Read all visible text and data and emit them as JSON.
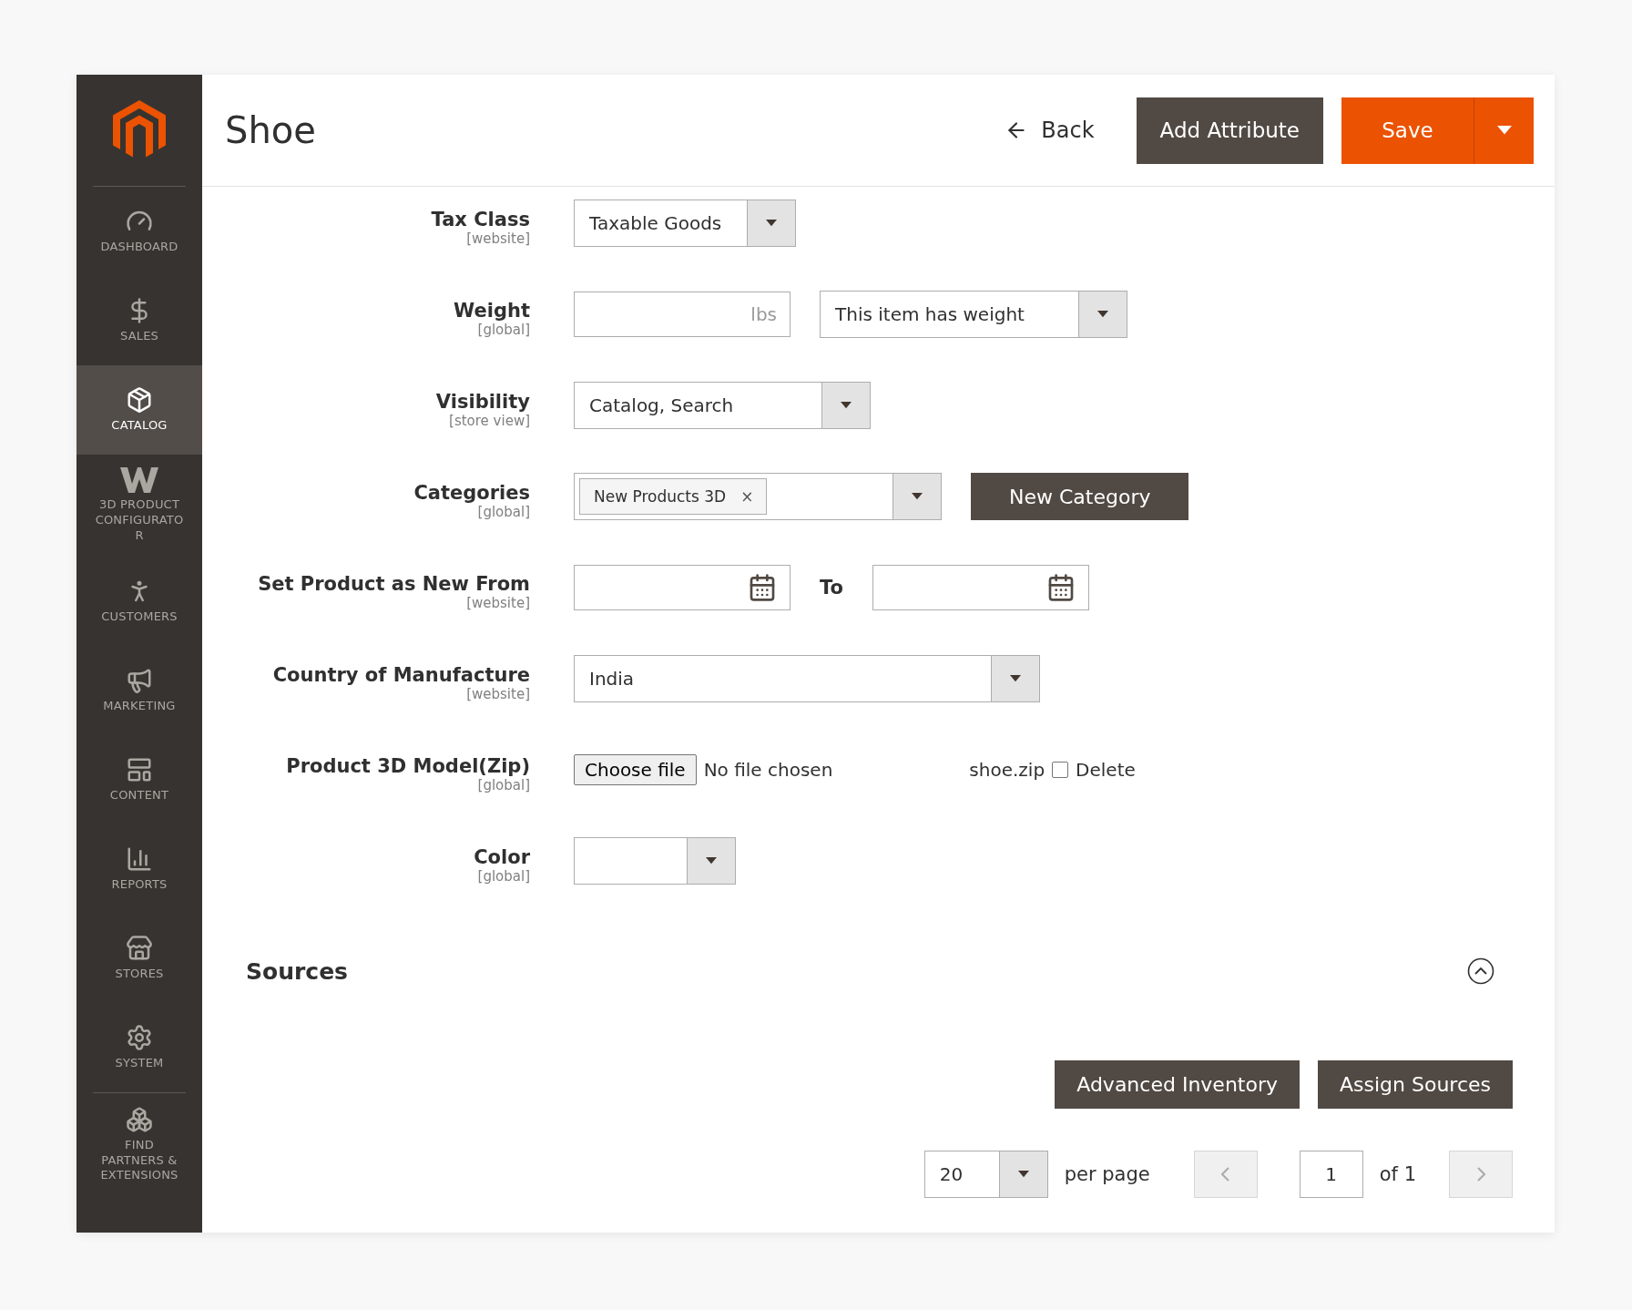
{
  "sidebar": {
    "items": [
      {
        "kind": "dashboard",
        "label": "DASHBOARD",
        "selected": false
      },
      {
        "kind": "sales",
        "label": "SALES",
        "selected": false
      },
      {
        "kind": "catalog",
        "label": "CATALOG",
        "selected": true
      },
      {
        "kind": "configurator",
        "label": "3D PRODUCT CONFIGURATO R",
        "selected": false
      },
      {
        "kind": "customers",
        "label": "CUSTOMERS",
        "selected": false
      },
      {
        "kind": "marketing",
        "label": "MARKETING",
        "selected": false
      },
      {
        "kind": "content",
        "label": "CONTENT",
        "selected": false
      },
      {
        "kind": "reports",
        "label": "REPORTS",
        "selected": false
      },
      {
        "kind": "stores",
        "label": "STORES",
        "selected": false
      },
      {
        "kind": "system",
        "label": "SYSTEM",
        "selected": false
      },
      {
        "kind": "partners",
        "label": "FIND PARTNERS & EXTENSIONS",
        "selected": false
      }
    ]
  },
  "header": {
    "title": "Shoe",
    "back": "Back",
    "add_attribute": "Add Attribute",
    "save": "Save"
  },
  "fields": [
    {
      "kind": "select",
      "label": "Tax Class",
      "scope": "[website]",
      "value": "Taxable Goods"
    },
    {
      "kind": "weight",
      "label": "Weight",
      "scope": "[global]",
      "unit": "lbs",
      "select_value": "This item has weight"
    },
    {
      "kind": "select",
      "label": "Visibility",
      "scope": "[store view]",
      "value": "Catalog, Search"
    },
    {
      "kind": "categories",
      "label": "Categories",
      "scope": "[global]",
      "tags": [
        "New Products 3D"
      ],
      "tag_remove": "×",
      "button": "New Category"
    },
    {
      "kind": "daterange",
      "label": "Set Product as New From",
      "scope": "[website]",
      "to": "To"
    },
    {
      "kind": "select",
      "label": "Country of Manufacture",
      "scope": "[website]",
      "value": "India"
    },
    {
      "kind": "file",
      "label": "Product 3D Model(Zip)",
      "scope": "[global]",
      "button": "Choose file",
      "status": "No file chosen",
      "file_name": "shoe.zip",
      "delete_label": "Delete",
      "delete_checked": false
    },
    {
      "kind": "select",
      "label": "Color",
      "scope": "[global]"
    }
  ],
  "sources": {
    "title": "Sources",
    "expanded": true,
    "buttons": [
      "Advanced Inventory",
      "Assign Sources"
    ],
    "pager": {
      "per_page_value": "20",
      "per_page_label": "per page",
      "page": "1",
      "of": "of 1"
    }
  }
}
